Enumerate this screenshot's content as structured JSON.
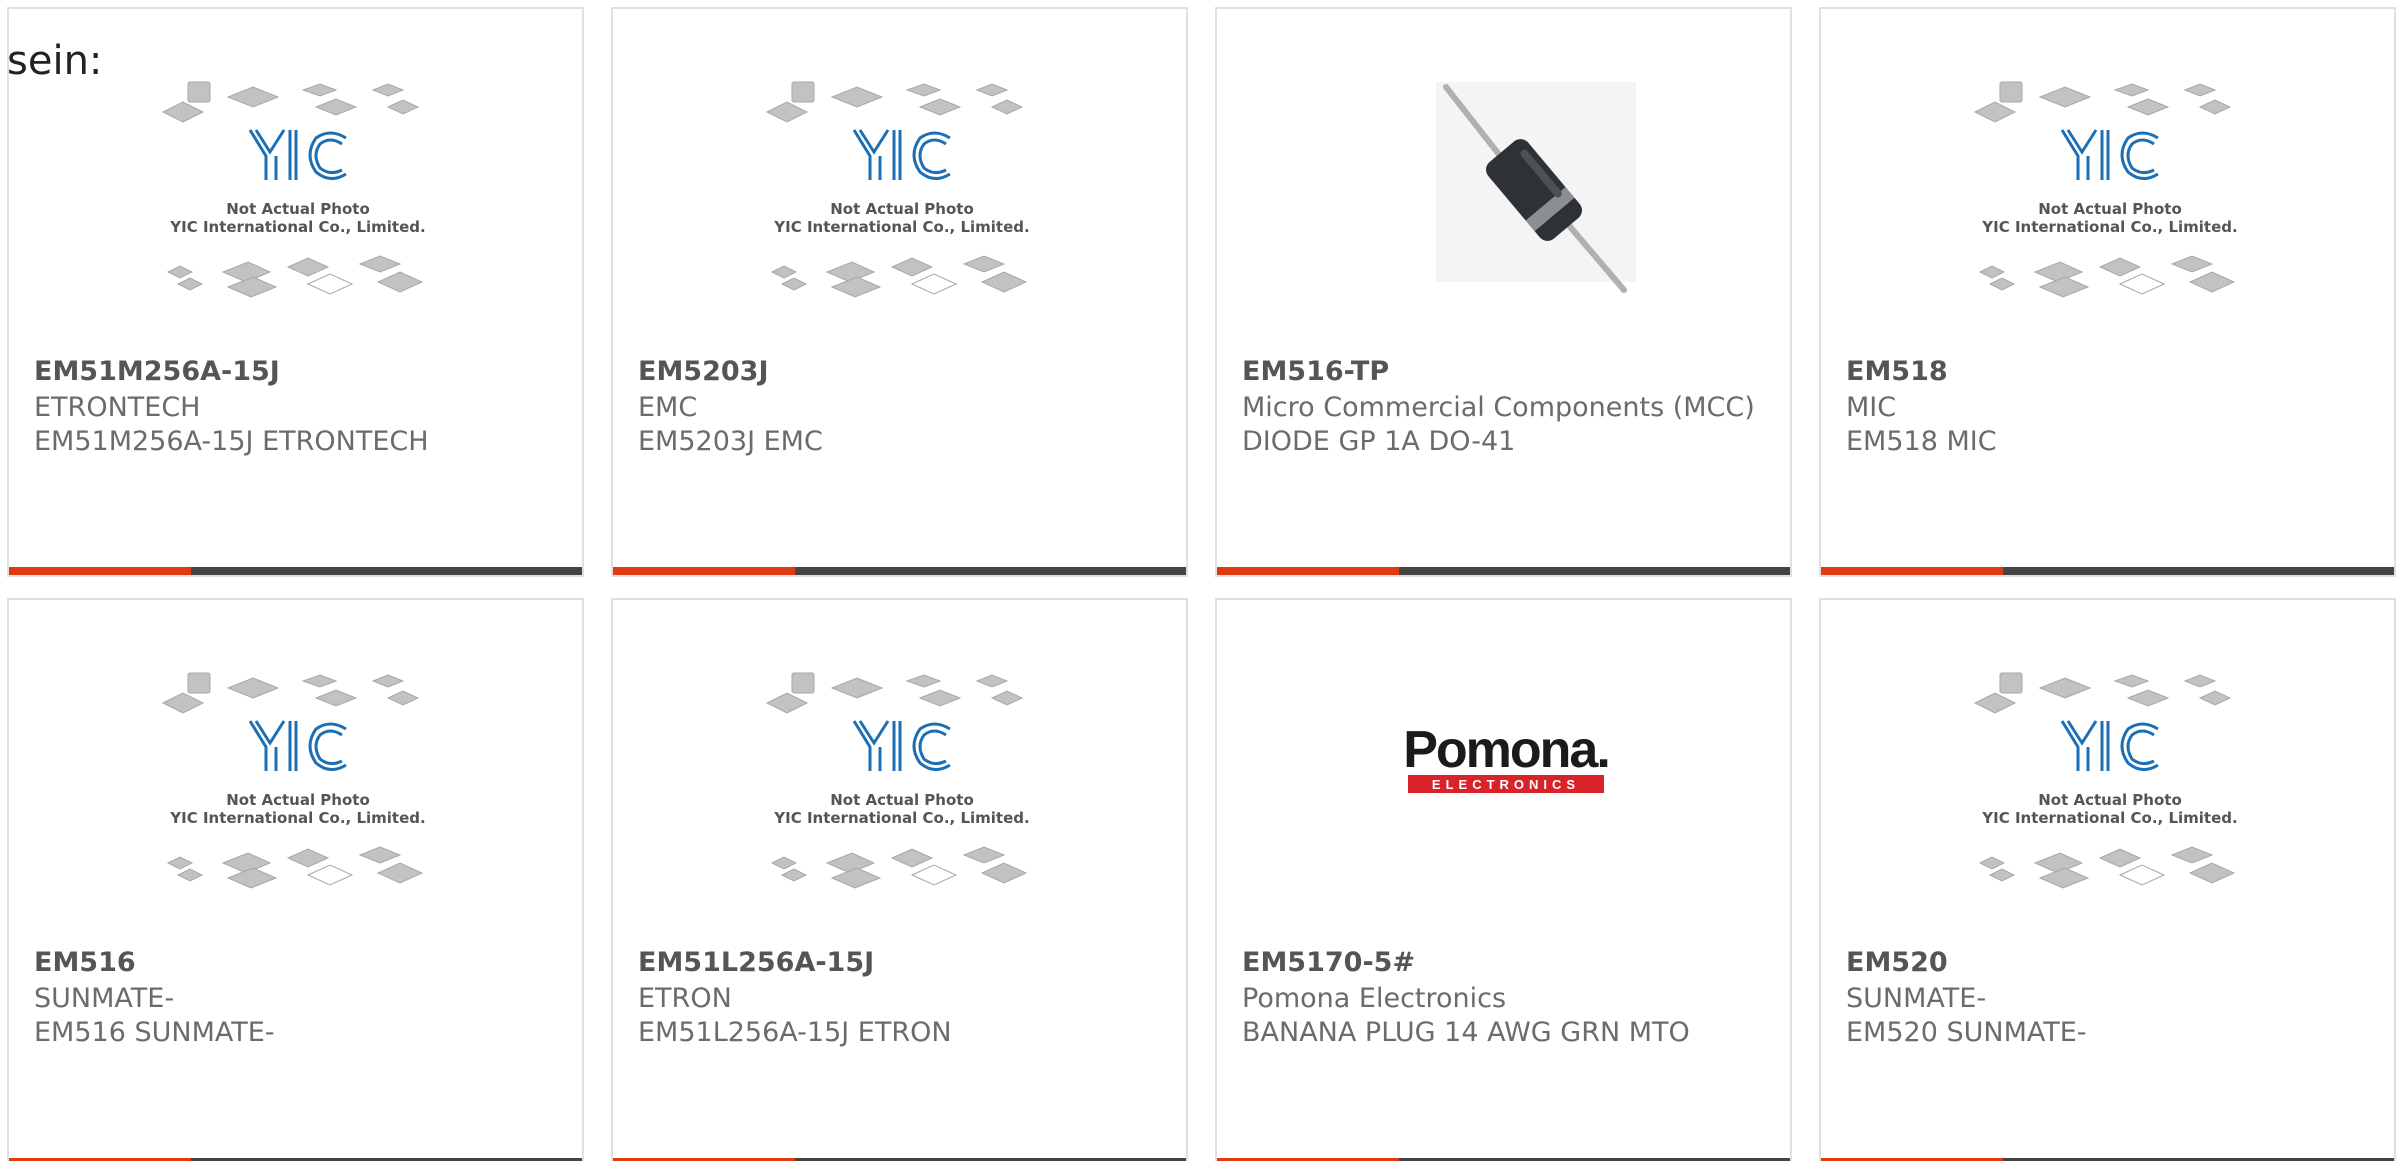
{
  "header": {
    "text": "sein:"
  },
  "placeholder": {
    "line1": "Not Actual Photo",
    "line2": "YIC International Co., Limited.",
    "logo": "YIC"
  },
  "pomona_logo": {
    "brand": "Pomona.",
    "sub": "ELECTRONICS"
  },
  "colors": {
    "accent": "#e03a10",
    "bar": "#444444",
    "yic_blue": "#1d6fb5",
    "pomona_red": "#d8232a"
  },
  "products": [
    {
      "part": "EM51M256A-15J",
      "maker": "ETRONTECH",
      "desc": "EM51M256A-15J ETRONTECH",
      "image": "yic-placeholder"
    },
    {
      "part": "EM5203J",
      "maker": "EMC",
      "desc": "EM5203J EMC",
      "image": "yic-placeholder"
    },
    {
      "part": "EM516-TP",
      "maker": "Micro Commercial Components (MCC)",
      "desc": "DIODE GP 1A DO-41",
      "image": "diode-photo"
    },
    {
      "part": "EM518",
      "maker": "MIC",
      "desc": "EM518 MIC",
      "image": "yic-placeholder"
    },
    {
      "part": "EM516",
      "maker": "SUNMATE-",
      "desc": "EM516 SUNMATE-",
      "image": "yic-placeholder"
    },
    {
      "part": "EM51L256A-15J",
      "maker": "ETRON",
      "desc": "EM51L256A-15J ETRON",
      "image": "yic-placeholder"
    },
    {
      "part": "EM5170-5#",
      "maker": "Pomona Electronics",
      "desc": "BANANA PLUG 14 AWG GRN MTO",
      "image": "pomona-logo"
    },
    {
      "part": "EM520",
      "maker": "SUNMATE-",
      "desc": "EM520 SUNMATE-",
      "image": "yic-placeholder"
    }
  ]
}
